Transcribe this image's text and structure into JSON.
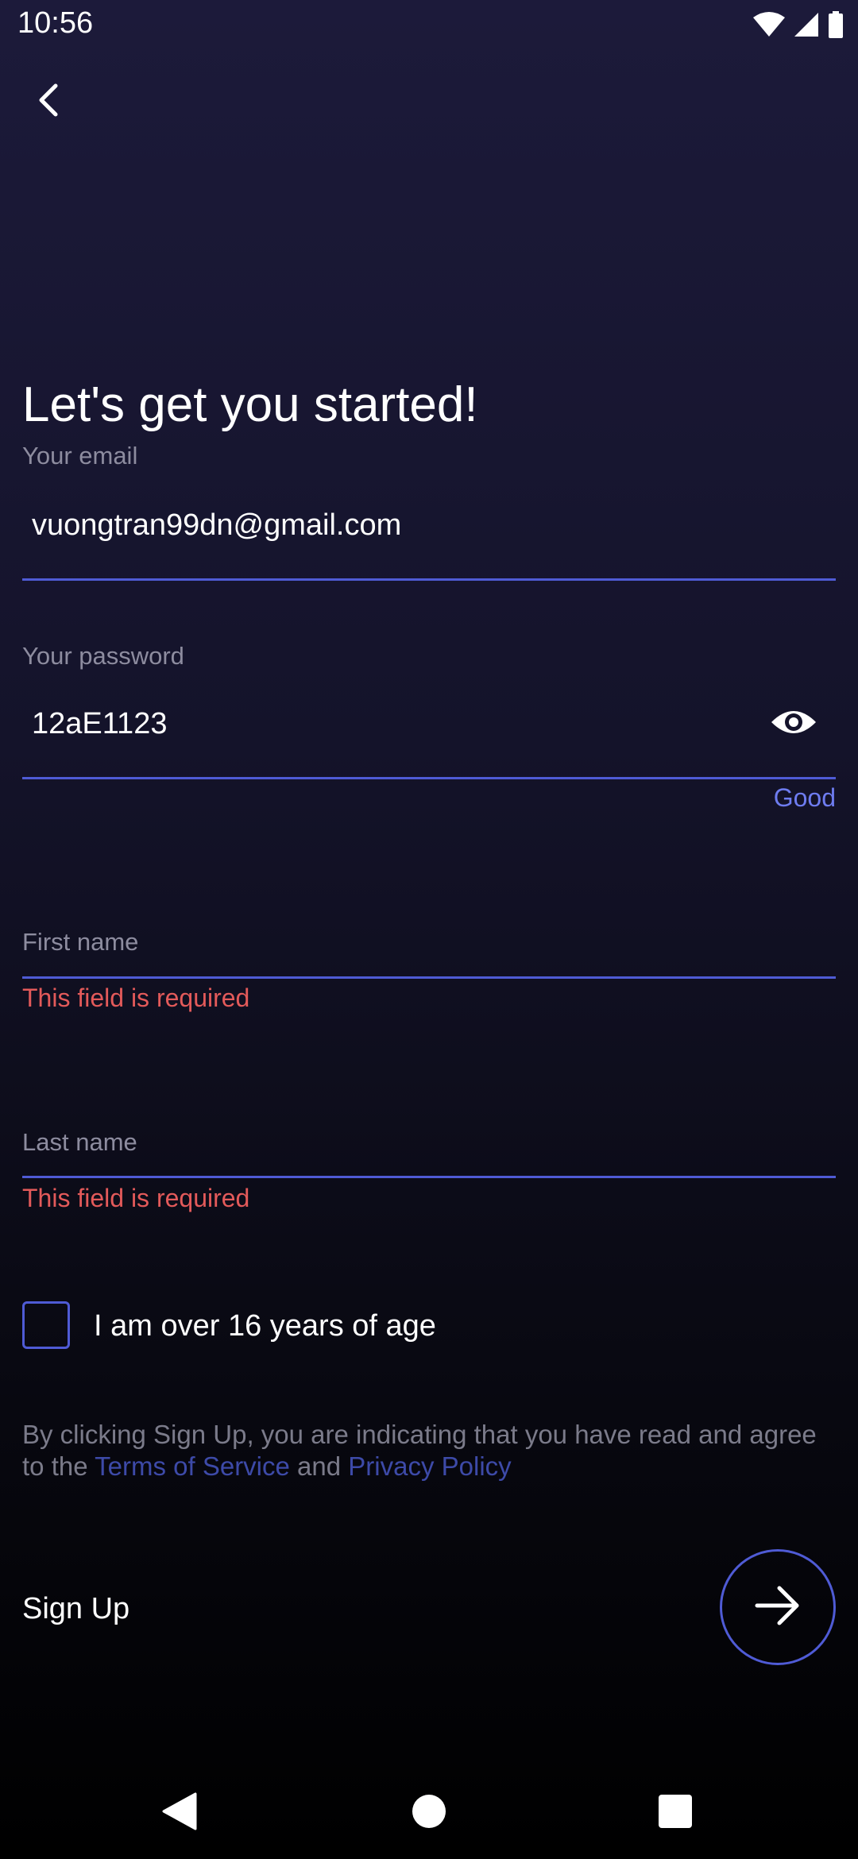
{
  "status_bar": {
    "time": "10:56",
    "icons": [
      "wifi-icon",
      "signal-icon",
      "battery-icon"
    ]
  },
  "header": {
    "back_icon": "chevron-left-icon"
  },
  "form": {
    "title": "Let's get you started!",
    "email": {
      "label": "Your email",
      "value": "vuongtran99dn@gmail.com"
    },
    "password": {
      "label": "Your password",
      "value": "12aE1123",
      "visibility_icon": "eye-icon",
      "strength": "Good"
    },
    "first_name": {
      "label": "First name",
      "value": "",
      "error": "This field is required"
    },
    "last_name": {
      "label": "Last name",
      "value": "",
      "error": "This field is required"
    },
    "age_checkbox": {
      "label": "I am over 16 years of age",
      "checked": false
    },
    "terms": {
      "prefix": "By clicking Sign Up, you are indicating that you have read and agree to the ",
      "terms_link": "Terms of Service",
      "connector": " and ",
      "privacy_link": "Privacy Policy"
    },
    "signup": {
      "label": "Sign Up",
      "icon": "arrow-right-icon"
    }
  },
  "nav_bar": {
    "buttons": [
      "back-triangle-icon",
      "home-circle-icon",
      "recents-square-icon"
    ]
  },
  "colors": {
    "accent": "#4f5bd5",
    "error": "#e35a5a",
    "link": "#3d4aa8",
    "strength_good": "#6e7cf0"
  }
}
